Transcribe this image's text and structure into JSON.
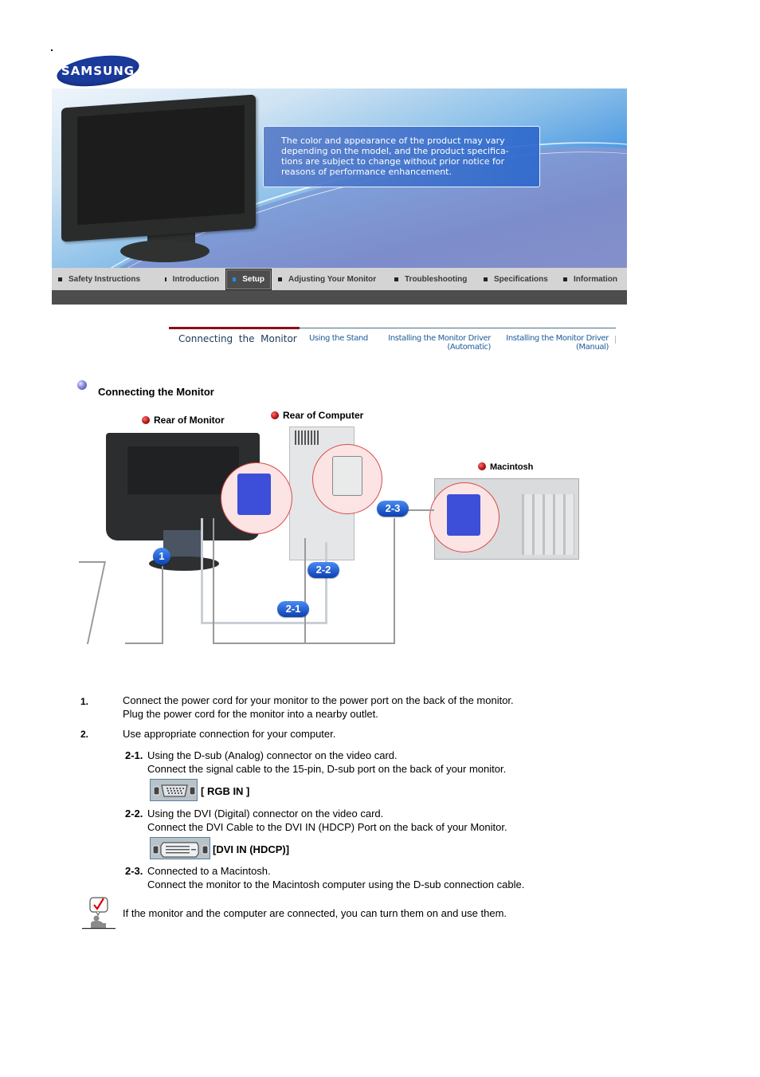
{
  "brand": {
    "logo_text": "SAMSUNG",
    "accent_color": "#1a3a9c"
  },
  "banner": {
    "notice_lines": [
      "The color and appearance of the product may vary",
      "depending on the model, and the product specifica-",
      "tions are subject to change without prior notice for",
      "reasons of performance enhancement."
    ]
  },
  "main_nav": {
    "items": [
      {
        "label": "Safety Instructions",
        "active": false
      },
      {
        "label": "Introduction",
        "active": false
      },
      {
        "label": "Setup",
        "active": true
      },
      {
        "label": "Adjusting Your Monitor",
        "active": false
      },
      {
        "label": "Troubleshooting",
        "active": false
      },
      {
        "label": "Specifications",
        "active": false
      },
      {
        "label": "Information",
        "active": false
      }
    ]
  },
  "sub_nav": {
    "items": [
      {
        "label": "Connecting  the  Monitor",
        "active": true
      },
      {
        "label": "Using the Stand",
        "active": false
      },
      {
        "label": "Installing the Monitor Driver",
        "label2": "(Automatic)",
        "active": false
      },
      {
        "label": "Installing the Monitor Driver",
        "label2": "(Manual)",
        "active": false
      }
    ],
    "active_color": "#8a0e17"
  },
  "section": {
    "title": "Connecting the Monitor"
  },
  "diagram": {
    "labels": {
      "rear_monitor": "Rear of Monitor",
      "rear_computer": "Rear of Computer",
      "macintosh": "Macintosh"
    },
    "badges": [
      "1",
      "2-1",
      "2-2",
      "2-3"
    ]
  },
  "steps": [
    {
      "num": "1.",
      "lines": [
        "Connect the power cord for your monitor to the power port on the back of the monitor.",
        "Plug the power cord for the monitor into a nearby outlet."
      ]
    },
    {
      "num": "2.",
      "lines": [
        "Use appropriate connection for your computer."
      ]
    }
  ],
  "sub_steps": [
    {
      "num": "2-1.",
      "lines": [
        "Using the D-sub (Analog) connector on the video card.",
        "Connect the signal cable to the 15-pin, D-sub port on the back of your monitor."
      ],
      "port_label": "[ RGB IN ]",
      "port_icon": "vga-port-icon"
    },
    {
      "num": "2-2.",
      "lines": [
        "Using the DVI (Digital) connector on the video card.",
        "Connect the DVI Cable to the DVI IN (HDCP) Port on the back of your Monitor."
      ],
      "port_label": "[DVI IN (HDCP)]",
      "port_icon": "dvi-port-icon"
    },
    {
      "num": "2-3.",
      "lines": [
        "Connected to a Macintosh.",
        "Connect the monitor to the Macintosh computer using the D-sub connection cable."
      ]
    }
  ],
  "note": {
    "icon": "checkmark-note-icon",
    "text": "If the monitor and the computer are connected, you can turn them on and use them."
  }
}
